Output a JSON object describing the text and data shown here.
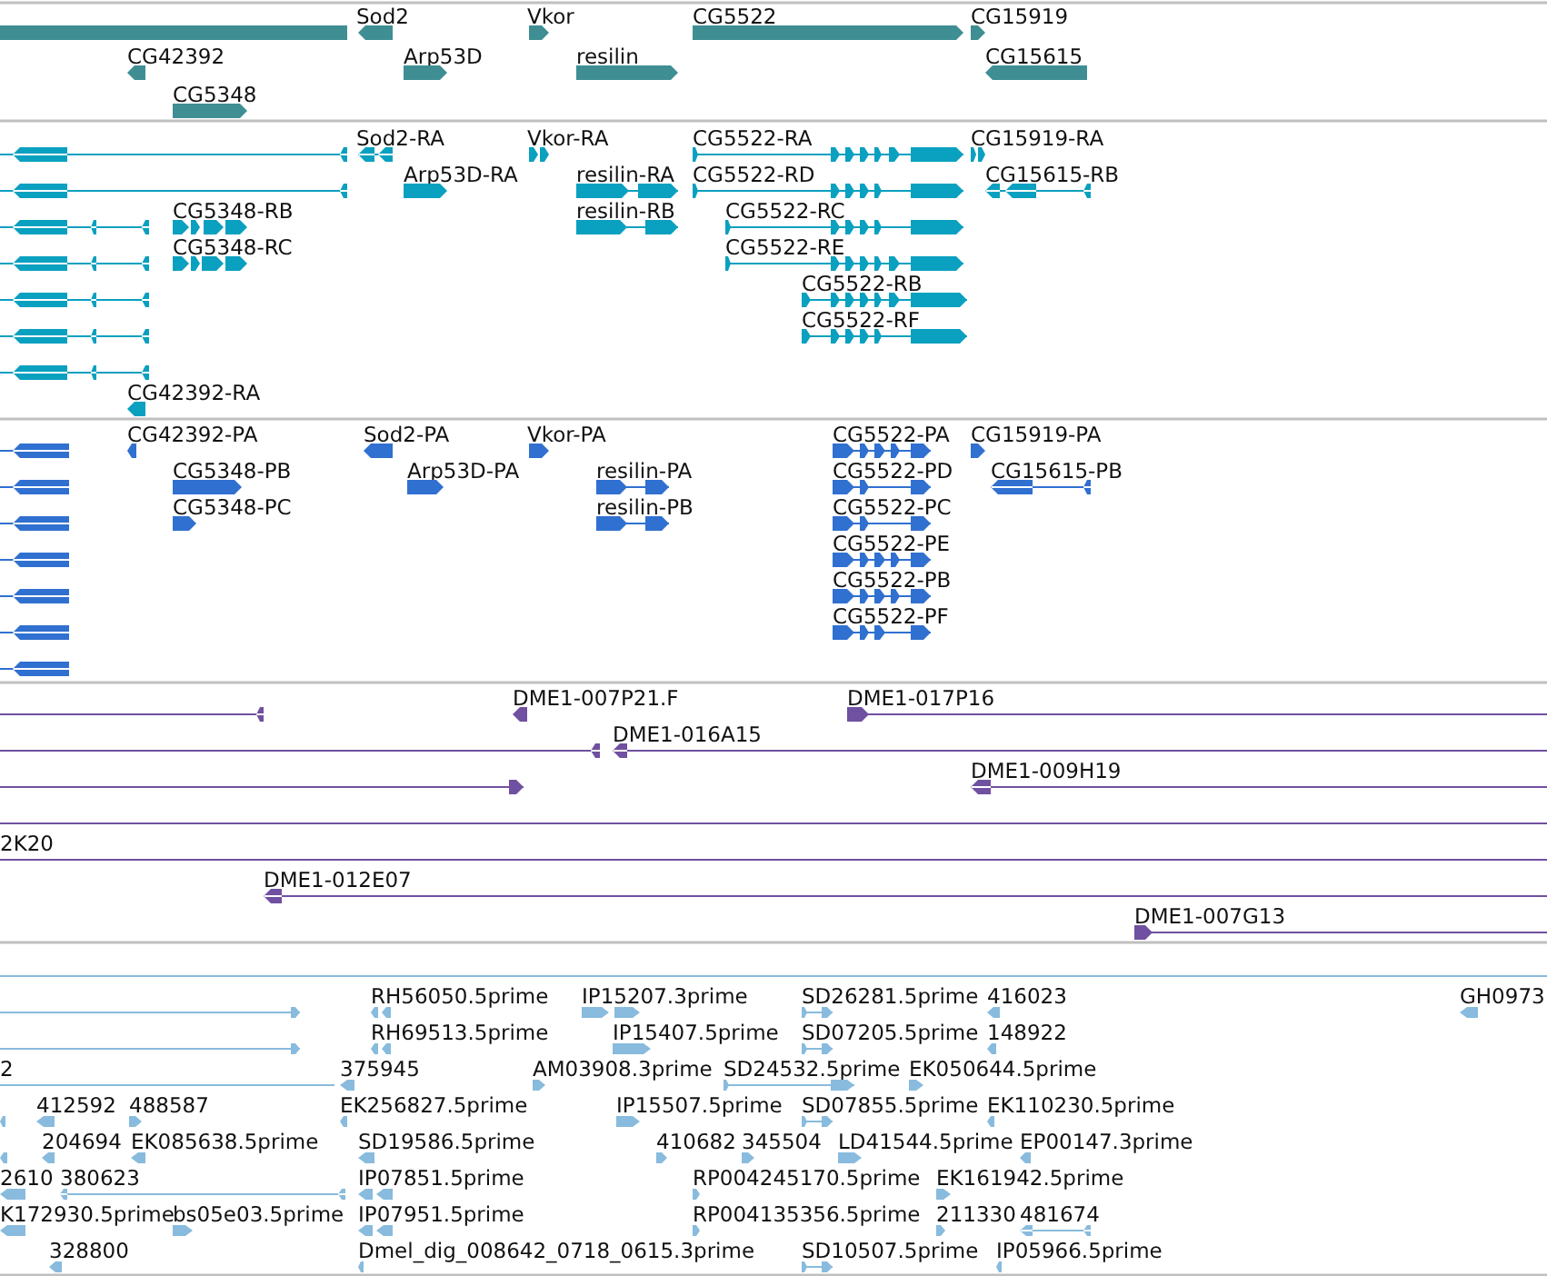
{
  "tracks": [
    {
      "kind": "gene",
      "features": [
        {
          "label": "Sod2",
          "reverse": true
        },
        {
          "label": "Vkor",
          "reverse": false
        },
        {
          "label": "CG5522",
          "reverse": false
        },
        {
          "label": "CG15919",
          "reverse": false
        },
        {
          "label": "CG42392",
          "reverse": true
        },
        {
          "label": "Arp53D",
          "reverse": false
        },
        {
          "label": "resilin",
          "reverse": false
        },
        {
          "label": "CG15615",
          "reverse": true
        },
        {
          "label": "CG5348",
          "reverse": false
        }
      ]
    },
    {
      "kind": "transcript",
      "features": [
        {
          "label": "Sod2-RA",
          "reverse": true
        },
        {
          "label": "Vkor-RA",
          "reverse": false
        },
        {
          "label": "CG5522-RA",
          "reverse": false
        },
        {
          "label": "CG15919-RA",
          "reverse": false
        },
        {
          "label": "Arp53D-RA",
          "reverse": false
        },
        {
          "label": "resilin-RA",
          "reverse": false
        },
        {
          "label": "CG5522-RD",
          "reverse": false
        },
        {
          "label": "CG15615-RB",
          "reverse": true
        },
        {
          "label": "CG5348-RB",
          "reverse": false
        },
        {
          "label": "resilin-RB",
          "reverse": false
        },
        {
          "label": "CG5522-RC",
          "reverse": false
        },
        {
          "label": "CG5348-RC",
          "reverse": false
        },
        {
          "label": "CG5522-RE",
          "reverse": false
        },
        {
          "label": "CG5522-RB",
          "reverse": false
        },
        {
          "label": "CG5522-RF",
          "reverse": false
        },
        {
          "label": "CG42392-RA",
          "reverse": true
        }
      ]
    },
    {
      "kind": "protein",
      "features": [
        {
          "label": "CG42392-PA",
          "reverse": true
        },
        {
          "label": "Sod2-PA",
          "reverse": true
        },
        {
          "label": "Vkor-PA",
          "reverse": false
        },
        {
          "label": "CG5522-PA",
          "reverse": false
        },
        {
          "label": "CG15919-PA",
          "reverse": false
        },
        {
          "label": "CG5348-PB",
          "reverse": false
        },
        {
          "label": "Arp53D-PA",
          "reverse": false
        },
        {
          "label": "resilin-PA",
          "reverse": false
        },
        {
          "label": "CG5522-PD",
          "reverse": false
        },
        {
          "label": "CG15615-PB",
          "reverse": true
        },
        {
          "label": "CG5348-PC",
          "reverse": false
        },
        {
          "label": "resilin-PB",
          "reverse": false
        },
        {
          "label": "CG5522-PC",
          "reverse": false
        },
        {
          "label": "CG5522-PE",
          "reverse": false
        },
        {
          "label": "CG5522-PB",
          "reverse": false
        },
        {
          "label": "CG5522-PF",
          "reverse": false
        }
      ]
    },
    {
      "kind": "clone",
      "features": [
        {
          "label": "DME1-007P21.F",
          "reverse": true
        },
        {
          "label": "DME1-017P16",
          "reverse": false
        },
        {
          "label": "DME1-016A15",
          "reverse": true
        },
        {
          "label": "DME1-009H19",
          "reverse": true
        },
        {
          "label": "2K20"
        },
        {
          "label": "DME1-012E07",
          "reverse": true
        },
        {
          "label": "DME1-007G13",
          "reverse": false
        }
      ]
    },
    {
      "kind": "est",
      "features": [
        {
          "label": "RH56050.5prime",
          "reverse": true
        },
        {
          "label": "IP15207.3prime",
          "reverse": false
        },
        {
          "label": "SD26281.5prime",
          "reverse": false
        },
        {
          "label": "416023",
          "reverse": true
        },
        {
          "label": "GH0973",
          "reverse": true
        },
        {
          "label": "RH69513.5prime",
          "reverse": true
        },
        {
          "label": "IP15407.5prime",
          "reverse": false
        },
        {
          "label": "SD07205.5prime",
          "reverse": false
        },
        {
          "label": "148922",
          "reverse": true
        },
        {
          "label": "2"
        },
        {
          "label": "375945",
          "reverse": true
        },
        {
          "label": "AM03908.3prime",
          "reverse": false
        },
        {
          "label": "SD24532.5prime",
          "reverse": false
        },
        {
          "label": "EK050644.5prime",
          "reverse": false
        },
        {
          "label": "412592",
          "reverse": true
        },
        {
          "label": "488587",
          "reverse": false
        },
        {
          "label": "EK256827.5prime",
          "reverse": true
        },
        {
          "label": "IP15507.5prime",
          "reverse": false
        },
        {
          "label": "SD07855.5prime",
          "reverse": false
        },
        {
          "label": "EK110230.5prime",
          "reverse": true
        },
        {
          "label": "204694",
          "reverse": true
        },
        {
          "label": "EK085638.5prime",
          "reverse": true
        },
        {
          "label": "SD19586.5prime",
          "reverse": true
        },
        {
          "label": "410682",
          "reverse": false
        },
        {
          "label": "345504",
          "reverse": false
        },
        {
          "label": "LD41544.5prime",
          "reverse": false
        },
        {
          "label": "EP00147.3prime",
          "reverse": true
        },
        {
          "label": "2610",
          "reverse": true
        },
        {
          "label": "380623",
          "reverse": true
        },
        {
          "label": "IP07851.5prime",
          "reverse": true
        },
        {
          "label": "RP004245170.5prime",
          "reverse": false
        },
        {
          "label": "EK161942.5prime",
          "reverse": false
        },
        {
          "label": "K172930.5prime",
          "reverse": true
        },
        {
          "label": "bs05e03.5prime",
          "reverse": false
        },
        {
          "label": "IP07951.5prime",
          "reverse": true
        },
        {
          "label": "RP004135356.5prime",
          "reverse": false
        },
        {
          "label": "211330",
          "reverse": false
        },
        {
          "label": "481674",
          "reverse": true
        },
        {
          "label": "328800",
          "reverse": true
        },
        {
          "label": "Dmel_dig_008642_0718_0615.3prime",
          "reverse": true
        },
        {
          "label": "SD10507.5prime",
          "reverse": false
        },
        {
          "label": "IP05966.5prime",
          "reverse": true
        }
      ]
    }
  ]
}
